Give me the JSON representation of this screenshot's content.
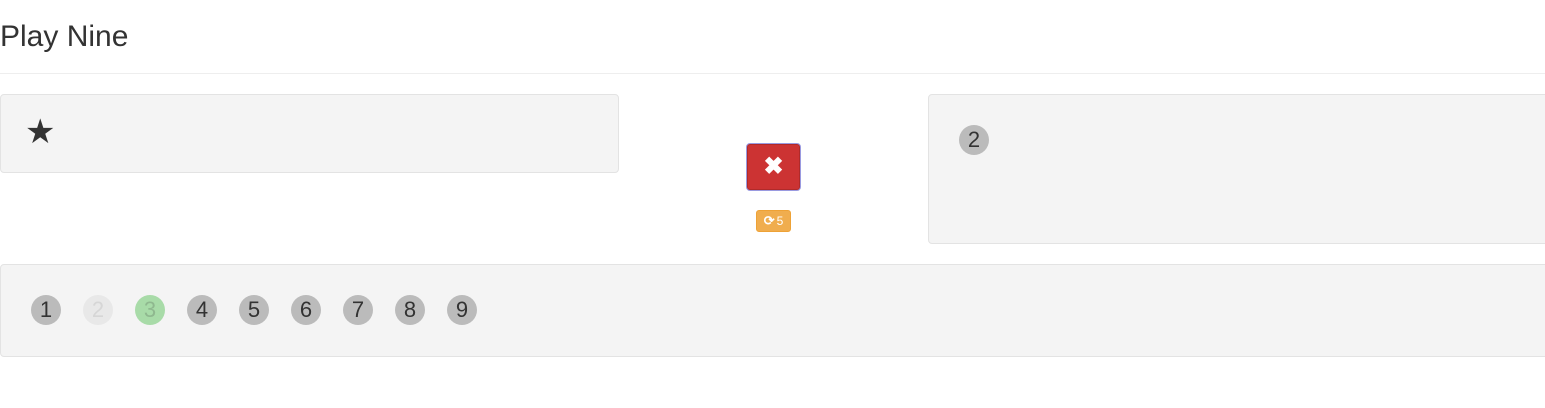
{
  "header": {
    "title": "Play Nine"
  },
  "stars_panel": {
    "star_count": 1,
    "icon": "star-icon",
    "star_glyph": "★"
  },
  "controls": {
    "check_button": {
      "icon": "times-icon",
      "glyph": "✖",
      "state": "wrong",
      "color": "#cc3333"
    },
    "redraw_button": {
      "icon": "refresh-icon",
      "glyph": "⟳",
      "count": "5",
      "color": "#f0ad4e"
    }
  },
  "answer_panel": {
    "selected_numbers": [
      "2"
    ]
  },
  "numbers_panel": {
    "numbers": [
      {
        "label": "1",
        "state": "available"
      },
      {
        "label": "2",
        "state": "used"
      },
      {
        "label": "3",
        "state": "selected"
      },
      {
        "label": "4",
        "state": "available"
      },
      {
        "label": "5",
        "state": "available"
      },
      {
        "label": "6",
        "state": "available"
      },
      {
        "label": "7",
        "state": "available"
      },
      {
        "label": "8",
        "state": "available"
      },
      {
        "label": "9",
        "state": "available"
      }
    ]
  },
  "colors": {
    "available": "#bbbbbb",
    "used": "#e8e8e8",
    "selected": "#a8dba8"
  }
}
